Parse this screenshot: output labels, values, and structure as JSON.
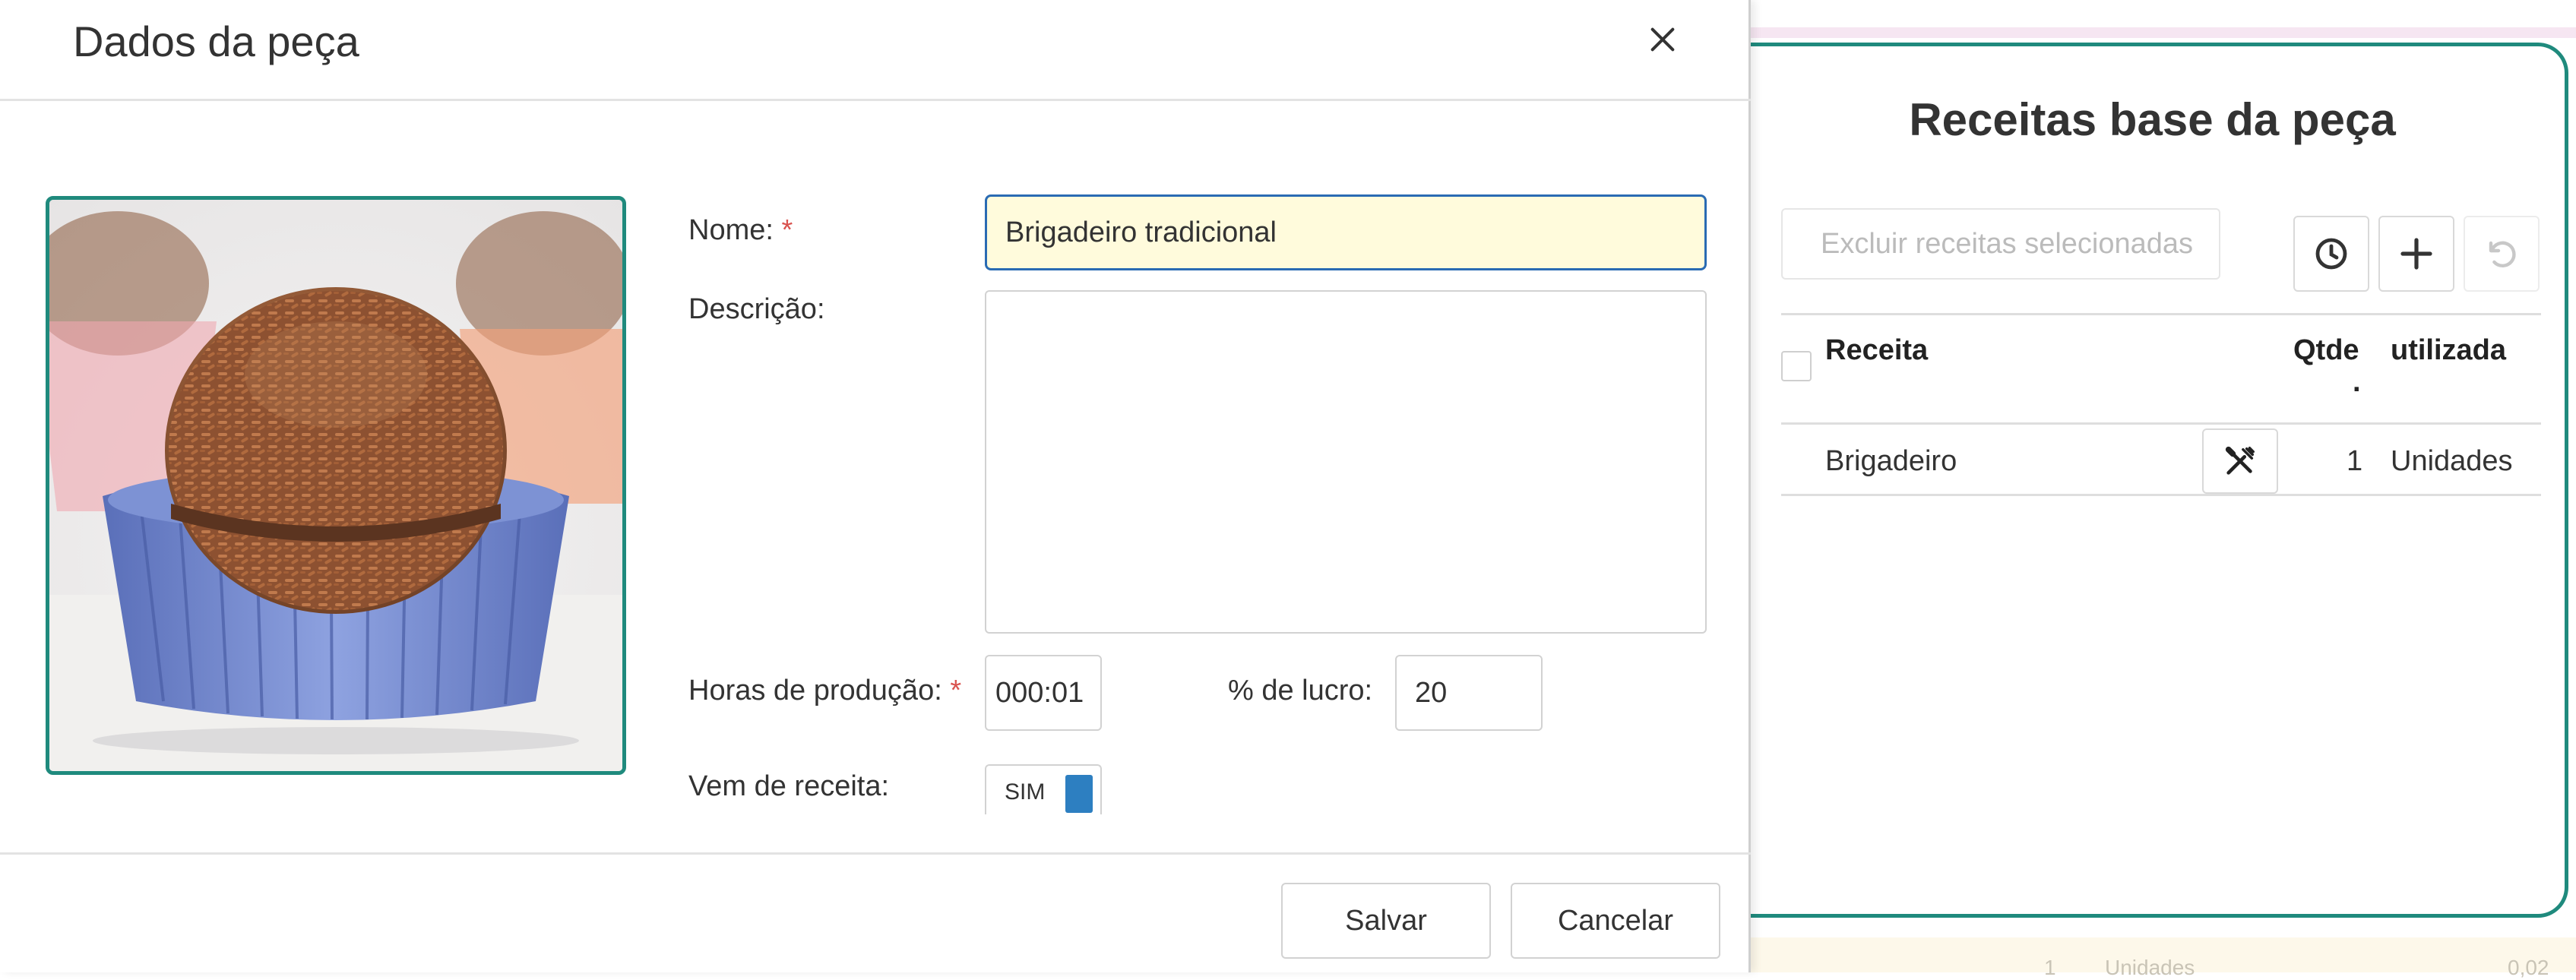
{
  "dialog": {
    "title": "Dados da peça",
    "form": {
      "nome_label": "Nome:",
      "nome_value": "Brigadeiro tradicional",
      "descricao_label": "Descrição:",
      "descricao_value": "",
      "horas_label": "Horas de produção:",
      "horas_value": "000:01",
      "lucro_label": "% de lucro:",
      "lucro_value": "20",
      "receita_label": "Vem de receita:",
      "receita_toggle_text": "SIM",
      "required_mark": "*"
    },
    "footer": {
      "save_label": "Salvar",
      "cancel_label": "Cancelar"
    }
  },
  "side_panel": {
    "title": "Receitas base da peça",
    "delete_selected_label": "Excluir receitas selecionadas",
    "table": {
      "headers": [
        "Receita",
        "Qtde",
        "utilizada"
      ],
      "header_dot": ".",
      "rows": [
        {
          "receita": "Brigadeiro",
          "qtde": "1",
          "unidade": "Unidades"
        }
      ]
    }
  },
  "background": {
    "qty": "1",
    "unit": "Unidades",
    "value": "0,02"
  },
  "colors": {
    "accent_teal": "#1f8a7d",
    "input_focus_border": "#2a6bb3",
    "input_focus_bg": "#fffbdc",
    "toggle_on": "#2d7fc1",
    "required": "#d9534f"
  }
}
